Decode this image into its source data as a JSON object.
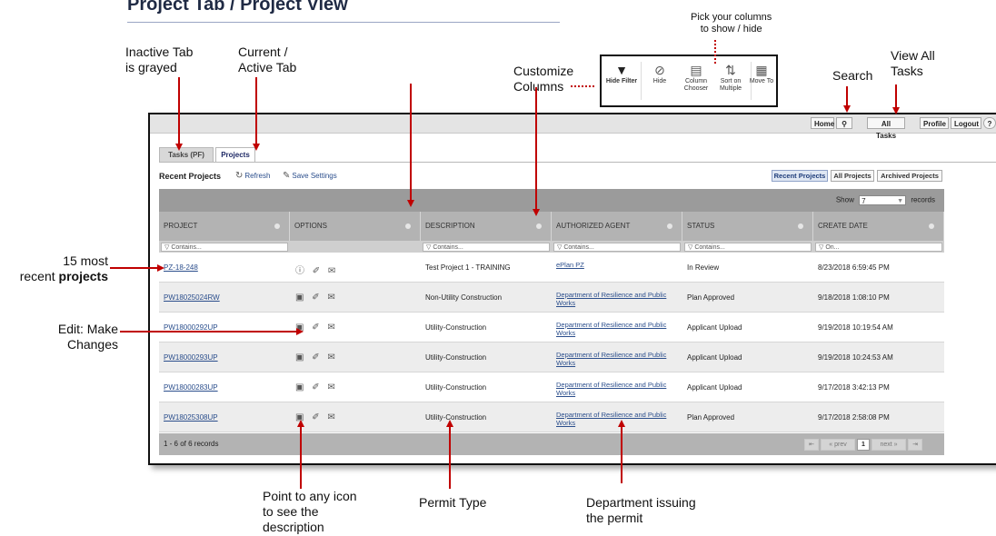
{
  "heading": "Project Tab / Project View",
  "annotations": {
    "inactive_tab": [
      "Inactive Tab",
      "is grayed"
    ],
    "active_tab": [
      "Current /",
      "Active Tab"
    ],
    "customize": [
      "Customize",
      "Columns"
    ],
    "pick_columns": [
      "Pick your columns",
      "to show / hide"
    ],
    "search": "Search",
    "view_all": [
      "View All",
      "Tasks"
    ],
    "recent": [
      "15 most",
      "recent ",
      "projects"
    ],
    "edit": [
      "Edit:  Make",
      "Changes"
    ],
    "point_icon": [
      "Point to any icon",
      "to see the",
      "description"
    ],
    "permit_type": "Permit Type",
    "department": [
      "Department issuing",
      "the permit"
    ]
  },
  "toolbar": {
    "items": [
      {
        "label": "Hide Filter",
        "icon": "filter-icon"
      },
      {
        "label": "Hide",
        "icon": "eye-slash-icon"
      },
      {
        "label": "Column Chooser",
        "icon": "column-chooser-icon"
      },
      {
        "label": "Sort on Multiple",
        "icon": "sort-icon"
      },
      {
        "label": "Move To",
        "icon": "move-icon"
      }
    ]
  },
  "app": {
    "topbar": {
      "home": "Home",
      "search_icon": "search-icon",
      "all_tasks": "All Tasks",
      "profile": "Profile",
      "logout": "Logout"
    },
    "tabs": {
      "inactive": "Tasks (PF)",
      "active": "Projects"
    },
    "section_title": "Recent Projects",
    "refresh": "Refresh",
    "save_settings": "Save Settings",
    "views": [
      "Recent Projects",
      "All Projects",
      "Archived Projects"
    ],
    "show": {
      "label": "Show",
      "value": "7",
      "suffix": "records"
    },
    "columns": [
      "PROJECT",
      "OPTIONS",
      "DESCRIPTION",
      "AUTHORIZED AGENT",
      "STATUS",
      "CREATE DATE"
    ],
    "filters": [
      "Contains...",
      "",
      "Contains...",
      "Contains...",
      "Contains...",
      "On..."
    ],
    "rows": [
      {
        "project": "PZ-18-248",
        "options": "ⓘ ✐ ✉",
        "description": "Test Project 1 - TRAINING",
        "agent": "ePlan PZ",
        "status": "In Review",
        "date": "8/23/2018 6:59:45 PM"
      },
      {
        "project": "PW18025024RW",
        "options": "▣ ✐ ✉",
        "description": "Non-Utility Construction",
        "agent": "Department of Resilience and Public Works",
        "status": "Plan Approved",
        "date": "9/18/2018 1:08:10 PM"
      },
      {
        "project": "PW18000292UP",
        "options": "▣ ✐ ✉",
        "description": "Utility-Construction",
        "agent": "Department of Resilience and Public Works",
        "status": "Applicant Upload",
        "date": "9/19/2018 10:19:54 AM"
      },
      {
        "project": "PW18000293UP",
        "options": "▣ ✐ ✉",
        "description": "Utility-Construction",
        "agent": "Department of Resilience and Public Works",
        "status": "Applicant Upload",
        "date": "9/19/2018 10:24:53 AM"
      },
      {
        "project": "PW18000283UP",
        "options": "▣ ✐ ✉",
        "description": "Utility-Construction",
        "agent": "Department of Resilience and Public Works",
        "status": "Applicant Upload",
        "date": "9/17/2018 3:42:13 PM"
      },
      {
        "project": "PW18025308UP",
        "options": "▣ ✐ ✉",
        "description": "Utility-Construction",
        "agent": "Department of Resilience and Public Works",
        "status": "Plan Approved",
        "date": "9/17/2018 2:58:08 PM"
      }
    ],
    "footer": "1 - 6 of 6 records",
    "pager": {
      "first": "⇤",
      "prev": "« prev",
      "page": "1",
      "next": "next »",
      "last": "⇥"
    }
  },
  "colors": {
    "arrow": "#c00000",
    "link": "#2b4e8c"
  }
}
